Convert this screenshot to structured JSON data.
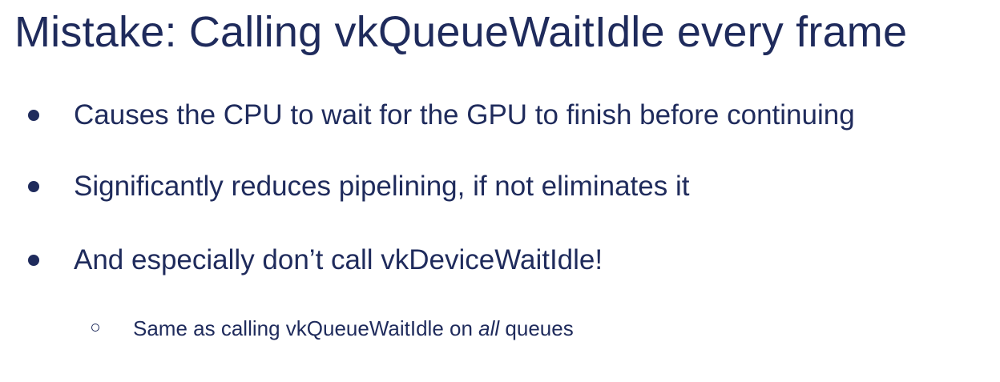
{
  "slide": {
    "title": "Mistake: Calling vkQueueWaitIdle every frame",
    "bullets": [
      {
        "text": "Causes the CPU to wait for the GPU to finish before continuing"
      },
      {
        "text": "Significantly reduces pipelining, if not eliminates it"
      },
      {
        "text": "And especially don’t call vkDeviceWaitIdle!"
      }
    ],
    "sub_bullet": {
      "before": "Same as calling vkQueueWaitIdle on ",
      "emphasis": "all",
      "after": " queues"
    }
  },
  "colors": {
    "text": "#1f2b5c",
    "background": "#ffffff"
  },
  "icons": {
    "bullet": "filled-circle-bullet",
    "sub_bullet": "hollow-circle-bullet"
  }
}
